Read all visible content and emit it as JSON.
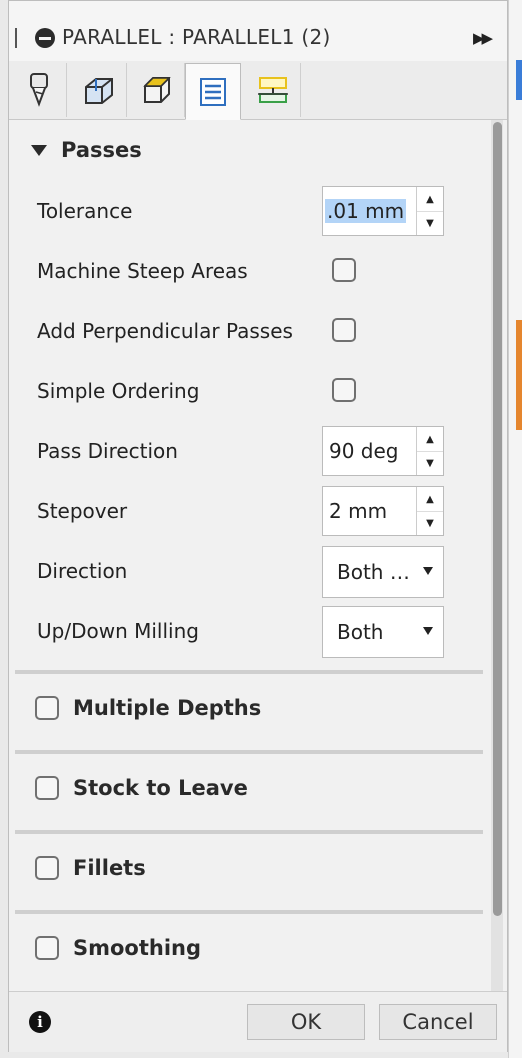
{
  "dialog": {
    "title": "PARALLEL : PARALLEL1 (2)",
    "tabs": [
      {
        "icon": "tool-icon"
      },
      {
        "icon": "geometry-icon"
      },
      {
        "icon": "heights-icon"
      },
      {
        "icon": "passes-icon",
        "active": true
      },
      {
        "icon": "linking-icon"
      }
    ]
  },
  "passes": {
    "header": "Passes",
    "fields": {
      "tolerance": {
        "label": "Tolerance",
        "value": ".01 mm"
      },
      "machine_steep": {
        "label": "Machine Steep Areas",
        "checked": false
      },
      "add_perpendicular": {
        "label": "Add Perpendicular Passes",
        "checked": false
      },
      "simple_ordering": {
        "label": "Simple Ordering",
        "checked": false
      },
      "pass_direction": {
        "label": "Pass Direction",
        "value": "90 deg"
      },
      "stepover": {
        "label": "Stepover",
        "value": "2 mm"
      },
      "direction": {
        "label": "Direction",
        "value": "Both ways"
      },
      "updown": {
        "label": "Up/Down Milling",
        "value": "Both"
      }
    }
  },
  "groups": {
    "multiple_depths": "Multiple Depths",
    "stock_to_leave": "Stock to Leave",
    "fillets": "Fillets",
    "smoothing": "Smoothing"
  },
  "footer": {
    "ok": "OK",
    "cancel": "Cancel",
    "info_glyph": "i"
  },
  "colors": {
    "selection": "#b3d4f7",
    "tab_accent_blue": "#2f6fbf",
    "tab_accent_yellow": "#e8c21d",
    "tab_accent_green": "#3aa048"
  }
}
